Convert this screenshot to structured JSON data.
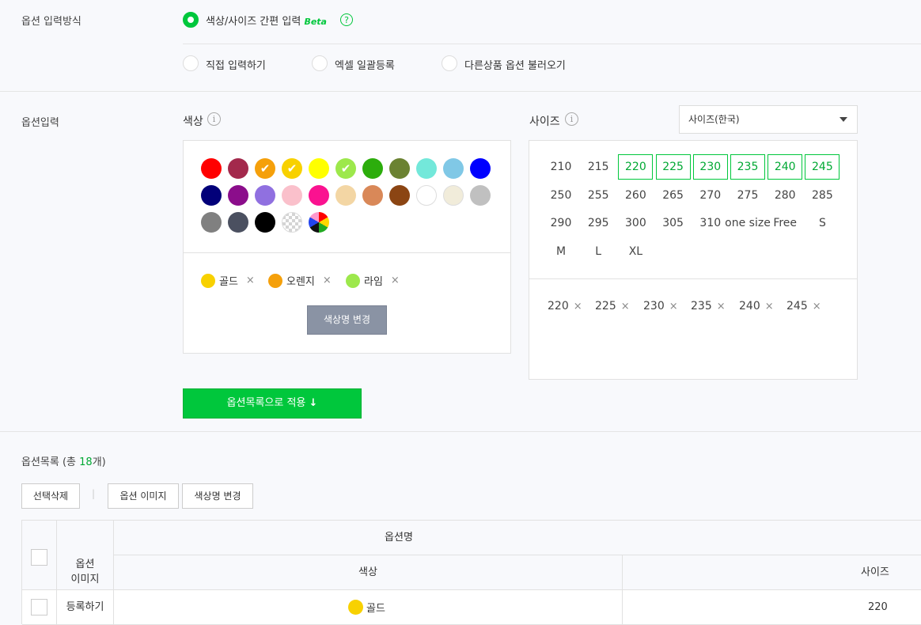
{
  "input_method": {
    "label": "옵션 입력방식",
    "options": [
      {
        "label": "색상/사이즈 간편 입력",
        "selected": true,
        "badge": "Beta"
      },
      {
        "label": "직접 입력하기",
        "selected": false
      },
      {
        "label": "엑셀 일괄등록",
        "selected": false
      },
      {
        "label": "다른상품 옵션 불러오기",
        "selected": false
      }
    ],
    "help_glyph": "?"
  },
  "option_input": {
    "label": "옵션입력",
    "color": {
      "title": "색상",
      "info_glyph": "i",
      "swatches": [
        {
          "color": "#ff0000",
          "checked": false
        },
        {
          "color": "#a3294c",
          "checked": false
        },
        {
          "color": "#f5a00b",
          "checked": true
        },
        {
          "color": "#f8d100",
          "checked": true
        },
        {
          "color": "#ffff00",
          "checked": false
        },
        {
          "color": "#9de84c",
          "checked": true
        },
        {
          "color": "#2cad0c",
          "checked": false
        },
        {
          "color": "#6b8232",
          "checked": false
        },
        {
          "color": "#73e8da",
          "checked": false
        },
        {
          "color": "#80c8e6",
          "checked": false
        },
        {
          "color": "#0000ff",
          "checked": false
        },
        {
          "color": "#020079",
          "checked": false
        },
        {
          "color": "#8b0d8b",
          "checked": false
        },
        {
          "color": "#9070e0",
          "checked": false
        },
        {
          "color": "#fac0cb",
          "checked": false
        },
        {
          "color": "#fa1290",
          "checked": false
        },
        {
          "color": "#f3d6a4",
          "checked": false
        },
        {
          "color": "#d98858",
          "checked": false
        },
        {
          "color": "#8b4513",
          "checked": false
        },
        {
          "color": "#ffffff",
          "checked": false
        },
        {
          "color": "#f1ecda",
          "checked": false
        },
        {
          "color": "#c0c0c0",
          "checked": false
        },
        {
          "color": "#808080",
          "checked": false
        },
        {
          "color": "#4b5060",
          "checked": false
        },
        {
          "color": "#000000",
          "checked": false
        },
        {
          "color": "transparent-pattern",
          "checked": false
        },
        {
          "color": "multicolor-pattern",
          "checked": false
        }
      ],
      "selected": [
        {
          "name": "골드",
          "color": "#f8d100"
        },
        {
          "name": "오렌지",
          "color": "#f5a00b"
        },
        {
          "name": "라임",
          "color": "#9de84c"
        }
      ],
      "remove_glyph": "×",
      "rename_button": "색상명 변경"
    },
    "size": {
      "title": "사이즈",
      "info_glyph": "i",
      "dropdown_value": "사이즈(한국)",
      "cells": [
        {
          "label": "210",
          "selected": false
        },
        {
          "label": "215",
          "selected": false
        },
        {
          "label": "220",
          "selected": true
        },
        {
          "label": "225",
          "selected": true
        },
        {
          "label": "230",
          "selected": true
        },
        {
          "label": "235",
          "selected": true
        },
        {
          "label": "240",
          "selected": true
        },
        {
          "label": "245",
          "selected": true
        },
        {
          "label": "250",
          "selected": false
        },
        {
          "label": "255",
          "selected": false
        },
        {
          "label": "260",
          "selected": false
        },
        {
          "label": "265",
          "selected": false
        },
        {
          "label": "270",
          "selected": false
        },
        {
          "label": "275",
          "selected": false
        },
        {
          "label": "280",
          "selected": false
        },
        {
          "label": "285",
          "selected": false
        },
        {
          "label": "290",
          "selected": false
        },
        {
          "label": "295",
          "selected": false
        },
        {
          "label": "300",
          "selected": false
        },
        {
          "label": "305",
          "selected": false
        },
        {
          "label": "310",
          "selected": false
        },
        {
          "label": "one size",
          "selected": false
        },
        {
          "label": "Free",
          "selected": false
        },
        {
          "label": "S",
          "selected": false
        },
        {
          "label": "M",
          "selected": false
        },
        {
          "label": "L",
          "selected": false
        },
        {
          "label": "XL",
          "selected": false
        }
      ],
      "selected": [
        "220",
        "225",
        "230",
        "235",
        "240",
        "245"
      ],
      "remove_glyph": "×"
    },
    "apply_button": "옵션목록으로 적용",
    "apply_arrow": "↓"
  },
  "option_list": {
    "title_prefix": "옵션목록 (총 ",
    "count": "18",
    "title_suffix": "개)",
    "buttons": {
      "delete_selected": "선택삭제",
      "option_image": "옵션 이미지",
      "rename_color": "색상명 변경"
    },
    "divider_glyph": "|",
    "table": {
      "col_image": "옵션\n이미지",
      "col_option_name": "옵션명",
      "col_color": "색상",
      "col_size": "사이즈",
      "rows": [
        {
          "image_action": "등록하기",
          "color_name": "골드",
          "color": "#f8d100",
          "size": "220"
        }
      ]
    }
  }
}
